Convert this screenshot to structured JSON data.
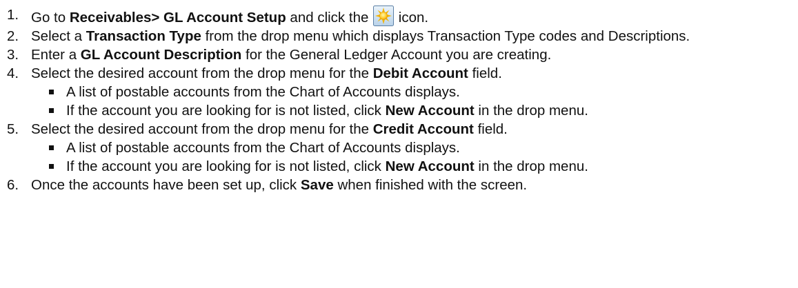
{
  "steps": [
    {
      "num": "1.",
      "segments": [
        {
          "t": "Go to ",
          "b": false
        },
        {
          "t": "Receivables> GL Account Setup",
          "b": true
        },
        {
          "t": " and click the ",
          "b": false
        },
        {
          "icon": "new-record-sun-icon"
        },
        {
          "t": " icon.",
          "b": false
        }
      ]
    },
    {
      "num": "2.",
      "segments": [
        {
          "t": "Select a ",
          "b": false
        },
        {
          "t": "Transaction Type",
          "b": true
        },
        {
          "t": " from the drop menu which displays Transaction Type codes and Descriptions.",
          "b": false
        }
      ],
      "wrap": true
    },
    {
      "num": "3.",
      "segments": [
        {
          "t": "Enter a ",
          "b": false
        },
        {
          "t": "GL Account Description",
          "b": true
        },
        {
          "t": " for the General Ledger Account you are creating.",
          "b": false
        }
      ]
    },
    {
      "num": "4.",
      "segments": [
        {
          "t": "Select the desired account from the drop menu for the ",
          "b": false
        },
        {
          "t": "Debit Account",
          "b": true
        },
        {
          "t": " field.",
          "b": false
        }
      ],
      "bullets": [
        [
          {
            "t": "A list of postable accounts from the Chart of Accounts displays.",
            "b": false
          }
        ],
        [
          {
            "t": "If the account you are looking for is not listed, click ",
            "b": false
          },
          {
            "t": "New Account",
            "b": true
          },
          {
            "t": " in the drop menu.",
            "b": false
          }
        ]
      ]
    },
    {
      "num": "5.",
      "segments": [
        {
          "t": "Select the desired account from the drop menu for the ",
          "b": false
        },
        {
          "t": "Credit Account",
          "b": true
        },
        {
          "t": " field.",
          "b": false
        }
      ],
      "bullets": [
        [
          {
            "t": "A list of postable accounts from the Chart of Accounts displays.",
            "b": false
          }
        ],
        [
          {
            "t": "If the account you are looking for is not listed, click ",
            "b": false
          },
          {
            "t": "New Account",
            "b": true
          },
          {
            "t": " in the drop menu.",
            "b": false
          }
        ]
      ]
    },
    {
      "num": "6.",
      "segments": [
        {
          "t": "Once the accounts have been set up, click ",
          "b": false
        },
        {
          "t": "Save",
          "b": true
        },
        {
          "t": " when finished with the screen.",
          "b": false
        }
      ]
    }
  ]
}
